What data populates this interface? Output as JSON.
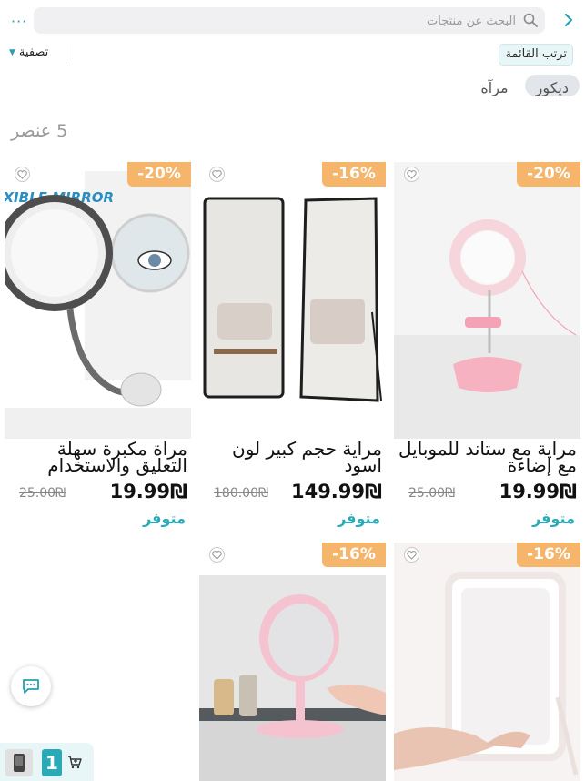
{
  "header": {
    "search_placeholder": "البحث عن منتجات",
    "menu_dots": "···"
  },
  "toolbar": {
    "sort_label": "ترتب القائمة",
    "filter_label": "تصفية"
  },
  "chips": [
    "ديكور",
    "مرآة"
  ],
  "item_count": "5 عنصر",
  "products": [
    {
      "title": "مراية مع ستاند للموبايل مع إضاءة",
      "price": "19.99₪",
      "old_price": "25.00₪",
      "discount": "20%-",
      "stock": "متوفر"
    },
    {
      "title": "مراية حجم كبير لون اسود",
      "price": "149.99₪",
      "old_price": "180.00₪",
      "discount": "16%-",
      "stock": "متوفر"
    },
    {
      "title": "مرآة مكبرة سهلة التعليق والاستخدام",
      "price": "19.99₪",
      "old_price": "25.00₪",
      "discount": "20%-",
      "stock": "متوفر",
      "image_text": "MY FLEXIBLE MIRROR"
    },
    {
      "discount": "16%-"
    },
    {
      "discount": "16%-"
    }
  ],
  "cart": {
    "count": "1"
  },
  "colors": {
    "accent": "#2aa9b6",
    "badge": "#f5b66b"
  }
}
